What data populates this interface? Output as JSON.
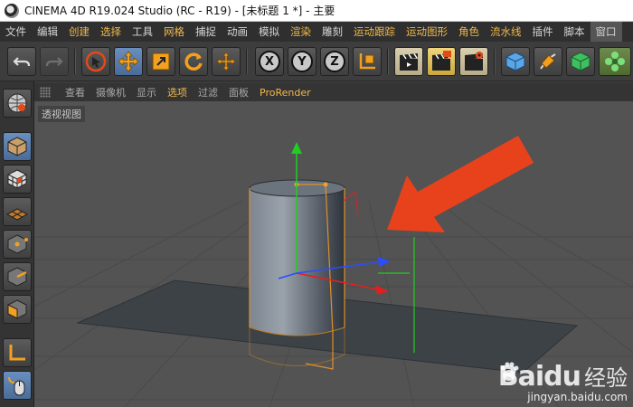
{
  "window": {
    "title": "CINEMA 4D R19.024 Studio (RC - R19) - [未标题 1 *] - 主要"
  },
  "menu": {
    "items": [
      "文件",
      "编辑",
      "创建",
      "选择",
      "工具",
      "网格",
      "捕捉",
      "动画",
      "模拟",
      "渲染",
      "雕刻",
      "运动跟踪",
      "运动图形",
      "角色",
      "流水线",
      "插件",
      "脚本",
      "窗口"
    ],
    "highlighted": [
      "创建",
      "选择",
      "网格",
      "渲染",
      "运动跟踪",
      "运动图形",
      "角色",
      "流水线"
    ]
  },
  "toolbar": {
    "undo": "undo-icon",
    "redo": "redo-icon",
    "axis_x": "X",
    "axis_y": "Y",
    "axis_z": "Z"
  },
  "viewport": {
    "menu": [
      "查看",
      "摄像机",
      "显示",
      "选项",
      "过滤",
      "面板",
      "ProRender"
    ],
    "highlighted": [
      "选项",
      "ProRender"
    ],
    "label": "透视视图"
  },
  "watermark": {
    "brand": "Bai",
    "brand_suffix": "du",
    "cn": "经验",
    "url": "jingyan.baidu.com"
  },
  "colors": {
    "accent": "#f1b84a",
    "arrow": "#e8421c",
    "y_axis": "#22cc22",
    "x_axis": "#e02020",
    "z_axis": "#2a4dff",
    "selection": "#f0a030"
  }
}
